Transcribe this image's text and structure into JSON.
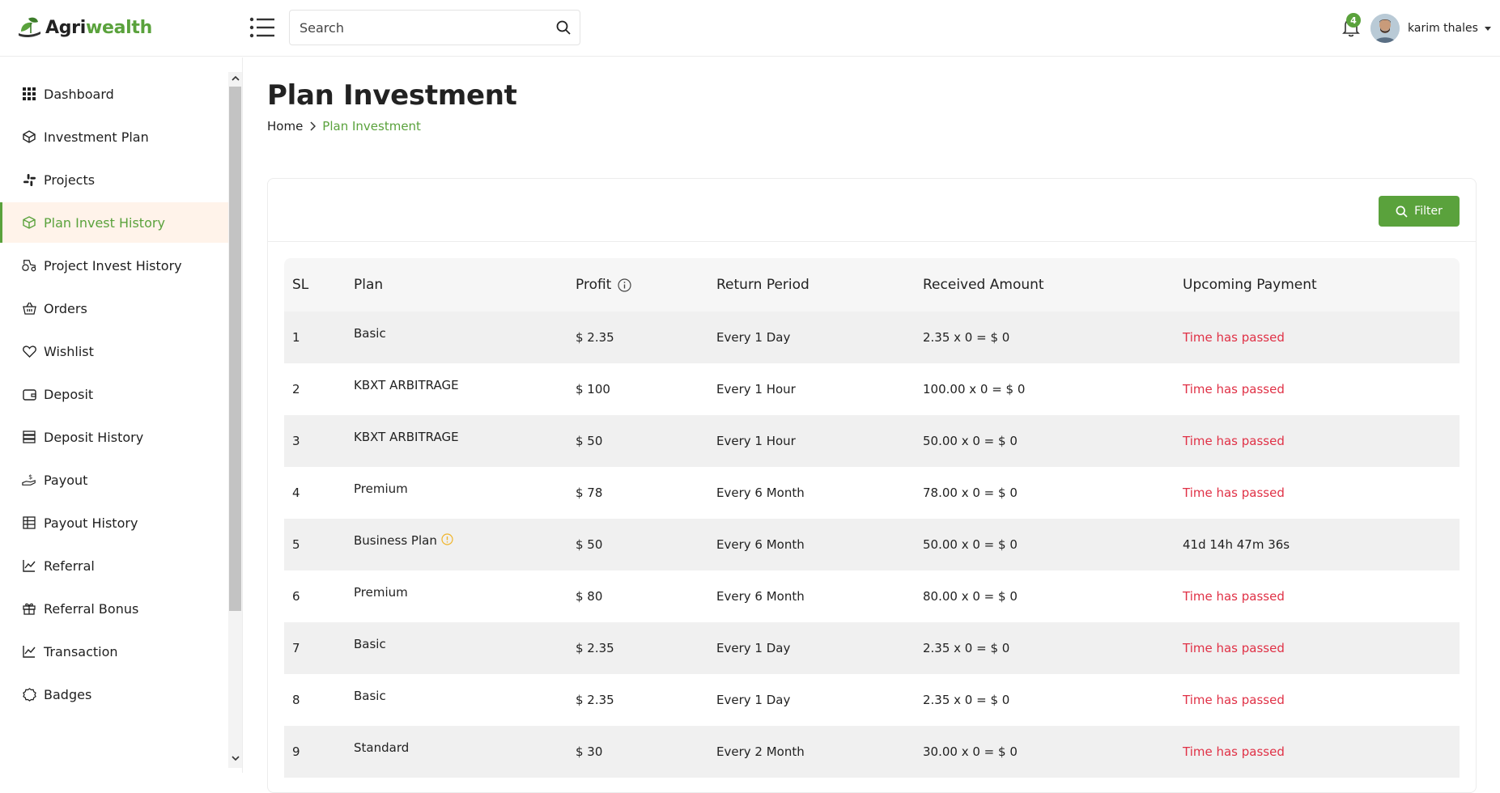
{
  "header": {
    "logo_part1": "Agri",
    "logo_part2": "wealth",
    "search_placeholder": "Search",
    "notification_count": "4",
    "user_name": "karim thales"
  },
  "sidebar": {
    "items": [
      {
        "label": "Dashboard",
        "icon": "grid-icon"
      },
      {
        "label": "Investment Plan",
        "icon": "cube-icon"
      },
      {
        "label": "Projects",
        "icon": "slack-icon"
      },
      {
        "label": "Plan Invest History",
        "icon": "box-icon",
        "active": true
      },
      {
        "label": "Project Invest History",
        "icon": "tractor-icon"
      },
      {
        "label": "Orders",
        "icon": "basket-icon"
      },
      {
        "label": "Wishlist",
        "icon": "heart-icon"
      },
      {
        "label": "Deposit",
        "icon": "wallet-icon"
      },
      {
        "label": "Deposit History",
        "icon": "server-icon"
      },
      {
        "label": "Payout",
        "icon": "hand-dollar-icon"
      },
      {
        "label": "Payout History",
        "icon": "table-icon"
      },
      {
        "label": "Referral",
        "icon": "chart-line-icon"
      },
      {
        "label": "Referral Bonus",
        "icon": "gift-icon"
      },
      {
        "label": "Transaction",
        "icon": "chart-line-icon"
      },
      {
        "label": "Badges",
        "icon": "badge-icon"
      }
    ]
  },
  "page": {
    "title": "Plan Investment",
    "breadcrumb_home": "Home",
    "breadcrumb_current": "Plan Investment"
  },
  "filter_label": "Filter",
  "table": {
    "headers": {
      "sl": "SL",
      "plan": "Plan",
      "profit": "Profit",
      "return_period": "Return Period",
      "received_amount": "Received Amount",
      "upcoming_payment": "Upcoming Payment"
    },
    "rows": [
      {
        "sl": "1",
        "plan": "Basic",
        "profit": "$ 2.35",
        "period": "Every 1 Day",
        "received": "2.35 x 0 = $ 0",
        "upcoming": "Time has passed",
        "passed": true
      },
      {
        "sl": "2",
        "plan": "KBXT ARBITRAGE",
        "profit": "$ 100",
        "period": "Every 1 Hour",
        "received": "100.00 x 0 = $ 0",
        "upcoming": "Time has passed",
        "passed": true
      },
      {
        "sl": "3",
        "plan": "KBXT ARBITRAGE",
        "profit": "$ 50",
        "period": "Every 1 Hour",
        "received": "50.00 x 0 = $ 0",
        "upcoming": "Time has passed",
        "passed": true
      },
      {
        "sl": "4",
        "plan": "Premium",
        "profit": "$ 78",
        "period": "Every 6 Month",
        "received": "78.00 x 0 = $ 0",
        "upcoming": "Time has passed",
        "passed": true
      },
      {
        "sl": "5",
        "plan": "Business Plan",
        "profit": "$ 50",
        "period": "Every 6 Month",
        "received": "50.00 x 0 = $ 0",
        "upcoming": "41d 14h 47m 36s",
        "passed": false,
        "warning": true
      },
      {
        "sl": "6",
        "plan": "Premium",
        "profit": "$ 80",
        "period": "Every 6 Month",
        "received": "80.00 x 0 = $ 0",
        "upcoming": "Time has passed",
        "passed": true
      },
      {
        "sl": "7",
        "plan": "Basic",
        "profit": "$ 2.35",
        "period": "Every 1 Day",
        "received": "2.35 x 0 = $ 0",
        "upcoming": "Time has passed",
        "passed": true
      },
      {
        "sl": "8",
        "plan": "Basic",
        "profit": "$ 2.35",
        "period": "Every 1 Day",
        "received": "2.35 x 0 = $ 0",
        "upcoming": "Time has passed",
        "passed": true
      },
      {
        "sl": "9",
        "plan": "Standard",
        "profit": "$ 30",
        "period": "Every 2 Month",
        "received": "30.00 x 0 = $ 0",
        "upcoming": "Time has passed",
        "passed": true
      }
    ]
  },
  "colors": {
    "accent": "#5aa23c",
    "danger": "#e03146",
    "active_bg": "#fff3ea"
  }
}
